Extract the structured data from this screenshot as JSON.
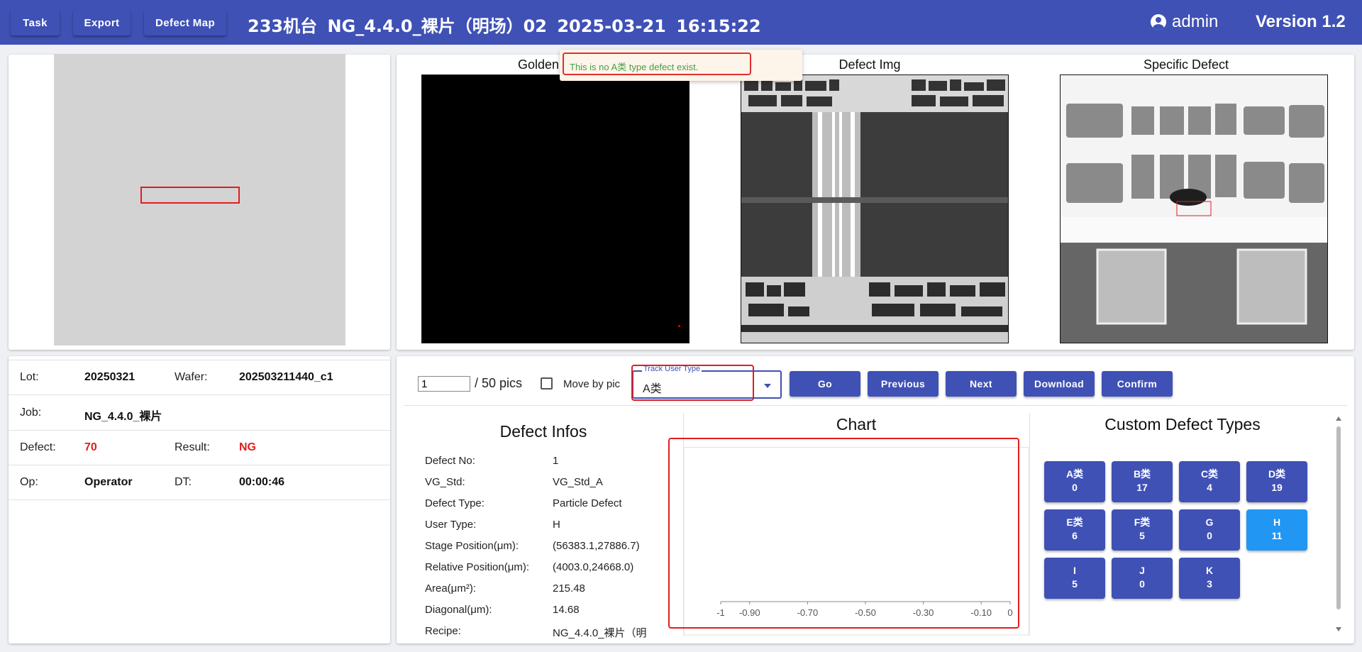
{
  "header": {
    "task_label": "Task",
    "export_label": "Export",
    "defect_map_label": "Defect Map",
    "title": "233机台 NG_4.4.0_裸片（明场）02 2025-03-21 16:15:22",
    "user": "admin",
    "version": "Version 1.2"
  },
  "toast": {
    "message": "This is no A类 type defect exist."
  },
  "images": {
    "golden_title": "Golden",
    "defect_title": "Defect Img",
    "specific_title": "Specific Defect"
  },
  "info": {
    "lot_label": "Lot:",
    "lot_value": "20250321",
    "wafer_label": "Wafer:",
    "wafer_value": "202503211440_c1",
    "job_label": "Job:",
    "job_value": "NG_4.4.0_裸片",
    "defect_label": "Defect:",
    "defect_value": "70",
    "result_label": "Result:",
    "result_value": "NG",
    "op_label": "Op:",
    "op_value": "Operator",
    "dt_label": "DT:",
    "dt_value": "00:00:46"
  },
  "controls": {
    "page_value": "1",
    "page_total": "/ 50 pics",
    "move_by_pic_label": "Move by pic",
    "track_user_type_label": "Track User Type",
    "track_user_type_value": "A类",
    "go_label": "Go",
    "previous_label": "Previous",
    "next_label": "Next",
    "download_label": "Download",
    "confirm_label": "Confirm"
  },
  "defect_infos": {
    "title": "Defect Infos",
    "rows": [
      {
        "label": "Defect No:",
        "value": "1"
      },
      {
        "label": "VG_Std:",
        "value": "VG_Std_A"
      },
      {
        "label": "Defect Type:",
        "value": "Particle Defect"
      },
      {
        "label": "User Type:",
        "value": "H"
      },
      {
        "label": "Stage Position(μm):",
        "value": "(56383.1,27886.7)"
      },
      {
        "label": "Relative Position(μm):",
        "value": "(4003.0,24668.0)"
      },
      {
        "label": "Area(μm²):",
        "value": "215.48"
      },
      {
        "label": "Diagonal(μm):",
        "value": "14.68"
      },
      {
        "label": "Recipe:",
        "value": "NG_4.4.0_裸片（明"
      }
    ]
  },
  "chart_data": {
    "type": "bar",
    "title": "Chart",
    "xlim": [
      -1,
      0
    ],
    "x_ticks": [
      "-1",
      "-0.90",
      "-0.70",
      "-0.50",
      "-0.30",
      "-0.10",
      "0"
    ],
    "x_tick_values": [
      -1,
      -0.9,
      -0.7,
      -0.5,
      -0.3,
      -0.1,
      0
    ],
    "series": []
  },
  "custom_types": {
    "title": "Custom Defect Types",
    "items": [
      {
        "name": "A类",
        "count": "0",
        "selected": false
      },
      {
        "name": "B类",
        "count": "17",
        "selected": false
      },
      {
        "name": "C类",
        "count": "4",
        "selected": false
      },
      {
        "name": "D类",
        "count": "19",
        "selected": false
      },
      {
        "name": "E类",
        "count": "6",
        "selected": false
      },
      {
        "name": "F类",
        "count": "5",
        "selected": false
      },
      {
        "name": "G",
        "count": "0",
        "selected": false
      },
      {
        "name": "H",
        "count": "11",
        "selected": true
      },
      {
        "name": "I",
        "count": "5",
        "selected": false
      },
      {
        "name": "J",
        "count": "0",
        "selected": false
      },
      {
        "name": "K",
        "count": "3",
        "selected": false
      }
    ]
  },
  "colors": {
    "primary": "#3f51b5",
    "selected": "#2196f3",
    "alert": "#e01e1e",
    "success_text": "#43a047"
  }
}
